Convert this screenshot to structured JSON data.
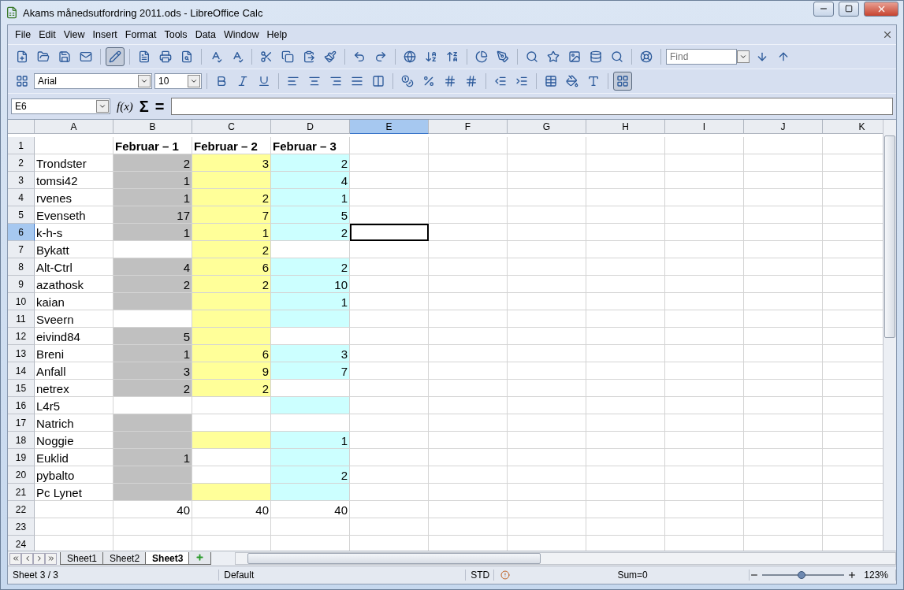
{
  "window": {
    "title": "Akams månedsutfordring 2011.ods - LibreOffice Calc"
  },
  "menu": [
    "File",
    "Edit",
    "View",
    "Insert",
    "Format",
    "Tools",
    "Data",
    "Window",
    "Help"
  ],
  "toolbar": {
    "edit_mode_pressed": true,
    "grid_pressed": true,
    "find": {
      "placeholder": "Find"
    },
    "font_name": "Arial",
    "font_size": "10"
  },
  "formula_bar": {
    "cell_ref": "E6",
    "function_wizard": "f(x)",
    "sum": "Σ",
    "equals": "="
  },
  "columns": [
    {
      "label": "A",
      "selected": false
    },
    {
      "label": "B",
      "selected": false
    },
    {
      "label": "C",
      "selected": false
    },
    {
      "label": "D",
      "selected": false
    },
    {
      "label": "E",
      "selected": true
    },
    {
      "label": "F",
      "selected": false
    },
    {
      "label": "G",
      "selected": false
    },
    {
      "label": "H",
      "selected": false
    },
    {
      "label": "I",
      "selected": false
    },
    {
      "label": "J",
      "selected": false
    },
    {
      "label": "K",
      "selected": false
    }
  ],
  "rows": [
    {
      "label": "1",
      "selected": false,
      "cells": [
        {},
        {
          "text": "Februar – 1",
          "kind": "header"
        },
        {
          "text": "Februar – 2",
          "kind": "header"
        },
        {
          "text": "Februar – 3",
          "kind": "header"
        }
      ]
    },
    {
      "label": "2",
      "selected": false,
      "cells": [
        {
          "text": "Trondster"
        },
        {
          "text": "2",
          "kind": "number",
          "color": "#c0c0c0"
        },
        {
          "text": "3",
          "kind": "number",
          "color": "#ffff99"
        },
        {
          "text": "2",
          "kind": "number",
          "color": "#ccffff"
        }
      ]
    },
    {
      "label": "3",
      "selected": false,
      "cells": [
        {
          "text": "tomsi42"
        },
        {
          "text": "1",
          "kind": "number",
          "color": "#c0c0c0"
        },
        {
          "color": "#ffff99"
        },
        {
          "text": "4",
          "kind": "number",
          "color": "#ccffff"
        }
      ]
    },
    {
      "label": "4",
      "selected": false,
      "cells": [
        {
          "text": "rvenes"
        },
        {
          "text": "1",
          "kind": "number",
          "color": "#c0c0c0"
        },
        {
          "text": "2",
          "kind": "number",
          "color": "#ffff99"
        },
        {
          "text": "1",
          "kind": "number",
          "color": "#ccffff"
        }
      ]
    },
    {
      "label": "5",
      "selected": false,
      "cells": [
        {
          "text": "Evenseth"
        },
        {
          "text": "17",
          "kind": "number",
          "color": "#c0c0c0"
        },
        {
          "text": "7",
          "kind": "number",
          "color": "#ffff99"
        },
        {
          "text": "5",
          "kind": "number",
          "color": "#ccffff"
        }
      ]
    },
    {
      "label": "6",
      "selected": true,
      "cells": [
        {
          "text": "k-h-s"
        },
        {
          "text": "1",
          "kind": "number",
          "color": "#c0c0c0"
        },
        {
          "text": "1",
          "kind": "number",
          "color": "#ffff99"
        },
        {
          "text": "2",
          "kind": "number",
          "color": "#ccffff"
        }
      ]
    },
    {
      "label": "7",
      "selected": false,
      "cells": [
        {
          "text": "Bykatt"
        },
        {},
        {
          "text": "2",
          "kind": "number",
          "color": "#ffff99"
        },
        {}
      ]
    },
    {
      "label": "8",
      "selected": false,
      "cells": [
        {
          "text": "Alt-Ctrl"
        },
        {
          "text": "4",
          "kind": "number",
          "color": "#c0c0c0"
        },
        {
          "text": "6",
          "kind": "number",
          "color": "#ffff99"
        },
        {
          "text": "2",
          "kind": "number",
          "color": "#ccffff"
        }
      ]
    },
    {
      "label": "9",
      "selected": false,
      "cells": [
        {
          "text": "azathosk"
        },
        {
          "text": "2",
          "kind": "number",
          "color": "#c0c0c0"
        },
        {
          "text": "2",
          "kind": "number",
          "color": "#ffff99"
        },
        {
          "text": "10",
          "kind": "number",
          "color": "#ccffff"
        }
      ]
    },
    {
      "label": "10",
      "selected": false,
      "cells": [
        {
          "text": "kaian"
        },
        {
          "color": "#c0c0c0"
        },
        {
          "color": "#ffff99"
        },
        {
          "text": "1",
          "kind": "number",
          "color": "#ccffff"
        }
      ]
    },
    {
      "label": "11",
      "selected": false,
      "cells": [
        {
          "text": "Sveern"
        },
        {},
        {
          "color": "#ffff99"
        },
        {
          "color": "#ccffff"
        }
      ]
    },
    {
      "label": "12",
      "selected": false,
      "cells": [
        {
          "text": "eivind84"
        },
        {
          "text": "5",
          "kind": "number",
          "color": "#c0c0c0"
        },
        {
          "color": "#ffff99"
        },
        {}
      ]
    },
    {
      "label": "13",
      "selected": false,
      "cells": [
        {
          "text": "Breni"
        },
        {
          "text": "1",
          "kind": "number",
          "color": "#c0c0c0"
        },
        {
          "text": "6",
          "kind": "number",
          "color": "#ffff99"
        },
        {
          "text": "3",
          "kind": "number",
          "color": "#ccffff"
        }
      ]
    },
    {
      "label": "14",
      "selected": false,
      "cells": [
        {
          "text": "Anfall"
        },
        {
          "text": "3",
          "kind": "number",
          "color": "#c0c0c0"
        },
        {
          "text": "9",
          "kind": "number",
          "color": "#ffff99"
        },
        {
          "text": "7",
          "kind": "number",
          "color": "#ccffff"
        }
      ]
    },
    {
      "label": "15",
      "selected": false,
      "cells": [
        {
          "text": "netrex"
        },
        {
          "text": "2",
          "kind": "number",
          "color": "#c0c0c0"
        },
        {
          "text": "2",
          "kind": "number",
          "color": "#ffff99"
        },
        {}
      ]
    },
    {
      "label": "16",
      "selected": false,
      "cells": [
        {
          "text": "L4r5"
        },
        {},
        {},
        {
          "color": "#ccffff"
        }
      ]
    },
    {
      "label": "17",
      "selected": false,
      "cells": [
        {
          "text": "Natrich"
        },
        {
          "color": "#c0c0c0"
        },
        {},
        {}
      ]
    },
    {
      "label": "18",
      "selected": false,
      "cells": [
        {
          "text": "Noggie"
        },
        {
          "color": "#c0c0c0"
        },
        {
          "color": "#ffff99"
        },
        {
          "text": "1",
          "kind": "number",
          "color": "#ccffff"
        }
      ]
    },
    {
      "label": "19",
      "selected": false,
      "cells": [
        {
          "text": "Euklid"
        },
        {
          "text": "1",
          "kind": "number",
          "color": "#c0c0c0"
        },
        {},
        {
          "color": "#ccffff"
        }
      ]
    },
    {
      "label": "20",
      "selected": false,
      "cells": [
        {
          "text": "pybalto"
        },
        {
          "color": "#c0c0c0"
        },
        {},
        {
          "text": "2",
          "kind": "number",
          "color": "#ccffff"
        }
      ]
    },
    {
      "label": "21",
      "selected": false,
      "cells": [
        {
          "text": "Pc Lynet"
        },
        {
          "color": "#c0c0c0"
        },
        {
          "color": "#ffff99"
        },
        {
          "color": "#ccffff"
        }
      ]
    },
    {
      "label": "22",
      "selected": false,
      "cells": [
        {},
        {
          "text": "40",
          "kind": "number"
        },
        {
          "text": "40",
          "kind": "number"
        },
        {
          "text": "40",
          "kind": "number"
        }
      ]
    },
    {
      "label": "23",
      "selected": false,
      "cells": []
    },
    {
      "label": "24",
      "selected": false,
      "cells": []
    }
  ],
  "sheet_tabs": [
    {
      "label": "Sheet1",
      "selected": false
    },
    {
      "label": "Sheet2",
      "selected": false
    },
    {
      "label": "Sheet3",
      "selected": true
    }
  ],
  "status_bar": {
    "sheet": "Sheet 3 / 3",
    "page_style": "Default",
    "mode": "STD",
    "sum": "Sum=0",
    "zoom": {
      "level": 0.48,
      "reading": "123%"
    }
  }
}
